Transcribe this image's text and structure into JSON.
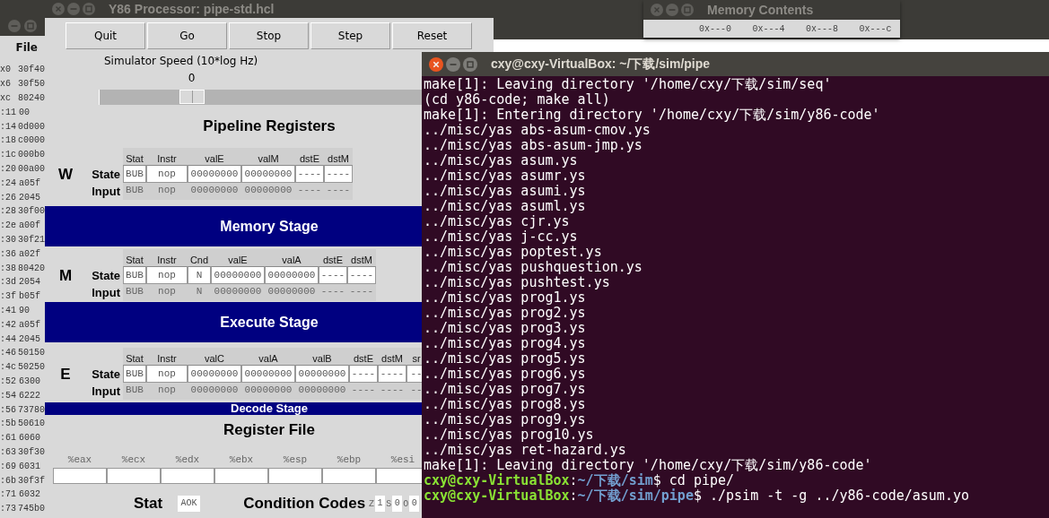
{
  "code_window": {
    "menu": [
      "File"
    ],
    "lines": [
      {
        "address": "x0",
        "bytes": "30f40"
      },
      {
        "address": "x6",
        "bytes": "30f50"
      },
      {
        "address": "xc",
        "bytes": "80240"
      },
      {
        "address": ":11",
        "bytes": "00"
      },
      {
        "address": ":14",
        "bytes": "0d000"
      },
      {
        "address": ":18",
        "bytes": "c0000"
      },
      {
        "address": ":1c",
        "bytes": "000b0"
      },
      {
        "address": ":20",
        "bytes": "00a00"
      },
      {
        "address": ":24",
        "bytes": "a05f"
      },
      {
        "address": ":26",
        "bytes": "2045"
      },
      {
        "address": ":28",
        "bytes": "30f00"
      },
      {
        "address": ":2e",
        "bytes": "a00f"
      },
      {
        "address": ":30",
        "bytes": "30f21"
      },
      {
        "address": ":36",
        "bytes": "a02f"
      },
      {
        "address": ":38",
        "bytes": "80420"
      },
      {
        "address": ":3d",
        "bytes": "2054"
      },
      {
        "address": ":3f",
        "bytes": "b05f"
      },
      {
        "address": ":41",
        "bytes": "90"
      },
      {
        "address": ":42",
        "bytes": "a05f"
      },
      {
        "address": ":44",
        "bytes": "2045"
      },
      {
        "address": ":46",
        "bytes": "50150"
      },
      {
        "address": ":4c",
        "bytes": "50250"
      },
      {
        "address": ":52",
        "bytes": "6300"
      },
      {
        "address": ":54",
        "bytes": "6222"
      },
      {
        "address": ":56",
        "bytes": "73780"
      },
      {
        "address": ":5b",
        "bytes": "50610"
      },
      {
        "address": ":61",
        "bytes": "6060"
      },
      {
        "address": ":63",
        "bytes": "30f30"
      },
      {
        "address": ":69",
        "bytes": "6031"
      },
      {
        "address": ":6b",
        "bytes": "30f3f"
      },
      {
        "address": ":71",
        "bytes": "6032"
      },
      {
        "address": ":73",
        "bytes": "745b0"
      }
    ]
  },
  "pipe_window": {
    "title": "Y86 Processor: pipe-std.hcl",
    "buttons": [
      "Quit",
      "Go",
      "Stop",
      "Step",
      "Reset"
    ],
    "speed": {
      "label": "Simulator Speed (10*log Hz)",
      "reading": "0",
      "level": 0.27
    },
    "heading": "Pipeline Registers",
    "blocks": [
      {
        "kind": "registers",
        "letter": "W",
        "state_label": "State",
        "input_label": "Input",
        "columns": [
          {
            "name": "Stat",
            "kind": "stat",
            "state": "BUB",
            "input": "BUB"
          },
          {
            "name": "Instr",
            "kind": "instr",
            "state": "nop",
            "input": "nop"
          },
          {
            "name": "valE",
            "kind": "word",
            "state": "00000000",
            "input": "00000000"
          },
          {
            "name": "valM",
            "kind": "word",
            "state": "00000000",
            "input": "00000000"
          },
          {
            "name": "dstE",
            "kind": "reg",
            "state": "----",
            "input": "----"
          },
          {
            "name": "dstM",
            "kind": "reg",
            "state": "----",
            "input": "----"
          }
        ]
      },
      {
        "kind": "bar",
        "title": "Memory Stage"
      },
      {
        "kind": "registers",
        "letter": "M",
        "state_label": "State",
        "input_label": "Input",
        "columns": [
          {
            "name": "Stat",
            "kind": "stat",
            "state": "BUB",
            "input": "BUB"
          },
          {
            "name": "Instr",
            "kind": "instr",
            "state": "nop",
            "input": "nop"
          },
          {
            "name": "Cnd",
            "kind": "flag",
            "state": "N",
            "input": "N"
          },
          {
            "name": "valE",
            "kind": "word",
            "state": "00000000",
            "input": "00000000"
          },
          {
            "name": "valA",
            "kind": "word",
            "state": "00000000",
            "input": "00000000"
          },
          {
            "name": "dstE",
            "kind": "reg",
            "state": "----",
            "input": "----"
          },
          {
            "name": "dstM",
            "kind": "reg",
            "state": "----",
            "input": "----"
          }
        ]
      },
      {
        "kind": "bar",
        "title": "Execute Stage"
      },
      {
        "kind": "registers",
        "letter": "E",
        "state_label": "State",
        "input_label": "Input",
        "columns": [
          {
            "name": "Stat",
            "kind": "stat",
            "state": "BUB",
            "input": "BUB"
          },
          {
            "name": "Instr",
            "kind": "instr",
            "state": "nop",
            "input": "nop"
          },
          {
            "name": "valC",
            "kind": "word",
            "state": "00000000",
            "input": "00000000"
          },
          {
            "name": "valA",
            "kind": "word",
            "state": "00000000",
            "input": "00000000"
          },
          {
            "name": "valB",
            "kind": "word",
            "state": "00000000",
            "input": "00000000"
          },
          {
            "name": "dstE",
            "kind": "reg",
            "state": "----",
            "input": "----"
          },
          {
            "name": "dstM",
            "kind": "reg",
            "state": "----",
            "input": "----"
          },
          {
            "name": "sr",
            "kind": "cut",
            "state": "--",
            "input": "--"
          }
        ]
      },
      {
        "kind": "bar",
        "title": "Decode Stage"
      }
    ],
    "register_file": {
      "title": "Register File",
      "registers": [
        "%eax",
        "%ecx",
        "%edx",
        "%ebx",
        "%esp",
        "%ebp",
        "%esi"
      ]
    },
    "status": {
      "label": "Stat",
      "value": "AOK",
      "cc_label": "Condition Codes",
      "flags": [
        {
          "name": "Z",
          "value": "1"
        },
        {
          "name": "S",
          "value": "0"
        },
        {
          "name": "O",
          "value": "0"
        }
      ]
    }
  },
  "memory_window": {
    "title": "Memory Contents",
    "columns": [
      "0x---0",
      "0x---4",
      "0x---8",
      "0x---c"
    ]
  },
  "terminal": {
    "title": "cxy@cxy-VirtualBox: ~/下载/sim/pipe",
    "lines": [
      {
        "kind": "output",
        "text": "make[1]: Leaving directory '/home/cxy/下载/sim/seq'"
      },
      {
        "kind": "output",
        "text": "(cd y86-code; make all)"
      },
      {
        "kind": "output",
        "text": "make[1]: Entering directory '/home/cxy/下载/sim/y86-code'"
      },
      {
        "kind": "output",
        "text": "../misc/yas abs-asum-cmov.ys"
      },
      {
        "kind": "output",
        "text": "../misc/yas abs-asum-jmp.ys"
      },
      {
        "kind": "output",
        "text": "../misc/yas asum.ys"
      },
      {
        "kind": "output",
        "text": "../misc/yas asumr.ys"
      },
      {
        "kind": "output",
        "text": "../misc/yas asumi.ys"
      },
      {
        "kind": "output",
        "text": "../misc/yas asuml.ys"
      },
      {
        "kind": "output",
        "text": "../misc/yas cjr.ys"
      },
      {
        "kind": "output",
        "text": "../misc/yas j-cc.ys"
      },
      {
        "kind": "output",
        "text": "../misc/yas poptest.ys"
      },
      {
        "kind": "output",
        "text": "../misc/yas pushquestion.ys"
      },
      {
        "kind": "output",
        "text": "../misc/yas pushtest.ys"
      },
      {
        "kind": "output",
        "text": "../misc/yas prog1.ys"
      },
      {
        "kind": "output",
        "text": "../misc/yas prog2.ys"
      },
      {
        "kind": "output",
        "text": "../misc/yas prog3.ys"
      },
      {
        "kind": "output",
        "text": "../misc/yas prog4.ys"
      },
      {
        "kind": "output",
        "text": "../misc/yas prog5.ys"
      },
      {
        "kind": "output",
        "text": "../misc/yas prog6.ys"
      },
      {
        "kind": "output",
        "text": "../misc/yas prog7.ys"
      },
      {
        "kind": "output",
        "text": "../misc/yas prog8.ys"
      },
      {
        "kind": "output",
        "text": "../misc/yas prog9.ys"
      },
      {
        "kind": "output",
        "text": "../misc/yas prog10.ys"
      },
      {
        "kind": "output",
        "text": "../misc/yas ret-hazard.ys"
      },
      {
        "kind": "output",
        "text": "make[1]: Leaving directory '/home/cxy/下载/sim/y86-code'"
      },
      {
        "kind": "prompt",
        "user": "cxy@cxy-VirtualBox",
        "separator": ":",
        "path": "~/下载/sim",
        "command": "$ cd pipe/"
      },
      {
        "kind": "prompt",
        "user": "cxy@cxy-VirtualBox",
        "separator": ":",
        "path": "~/下载/sim/pipe",
        "command": "$ ./psim -t -g ../y86-code/asum.yo"
      }
    ]
  }
}
